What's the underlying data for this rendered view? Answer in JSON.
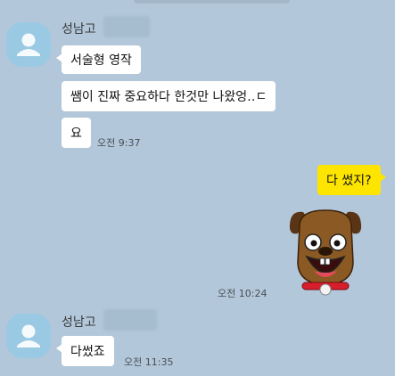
{
  "chat": {
    "groups": [
      {
        "sender": "성남고",
        "messages": [
          "서술형 영작",
          "쌤이 진짜 중요하다 한것만 나왔엉‥ㄷ",
          "요"
        ],
        "time": "오전 9:37"
      },
      {
        "mine": true,
        "message": "다 썼지?",
        "sticker_time": "오전 10:24"
      },
      {
        "sender": "성남고",
        "messages": [
          "다썼죠"
        ],
        "time": "오전 11:35"
      }
    ]
  },
  "sticker": {
    "name": "frodo-dog-sticker",
    "description_icon": "dog-face-icon"
  },
  "colors": {
    "background": "#b2c7da",
    "bubble_received": "#ffffff",
    "bubble_sent": "#fee500",
    "avatar": "#9ac9e4"
  }
}
